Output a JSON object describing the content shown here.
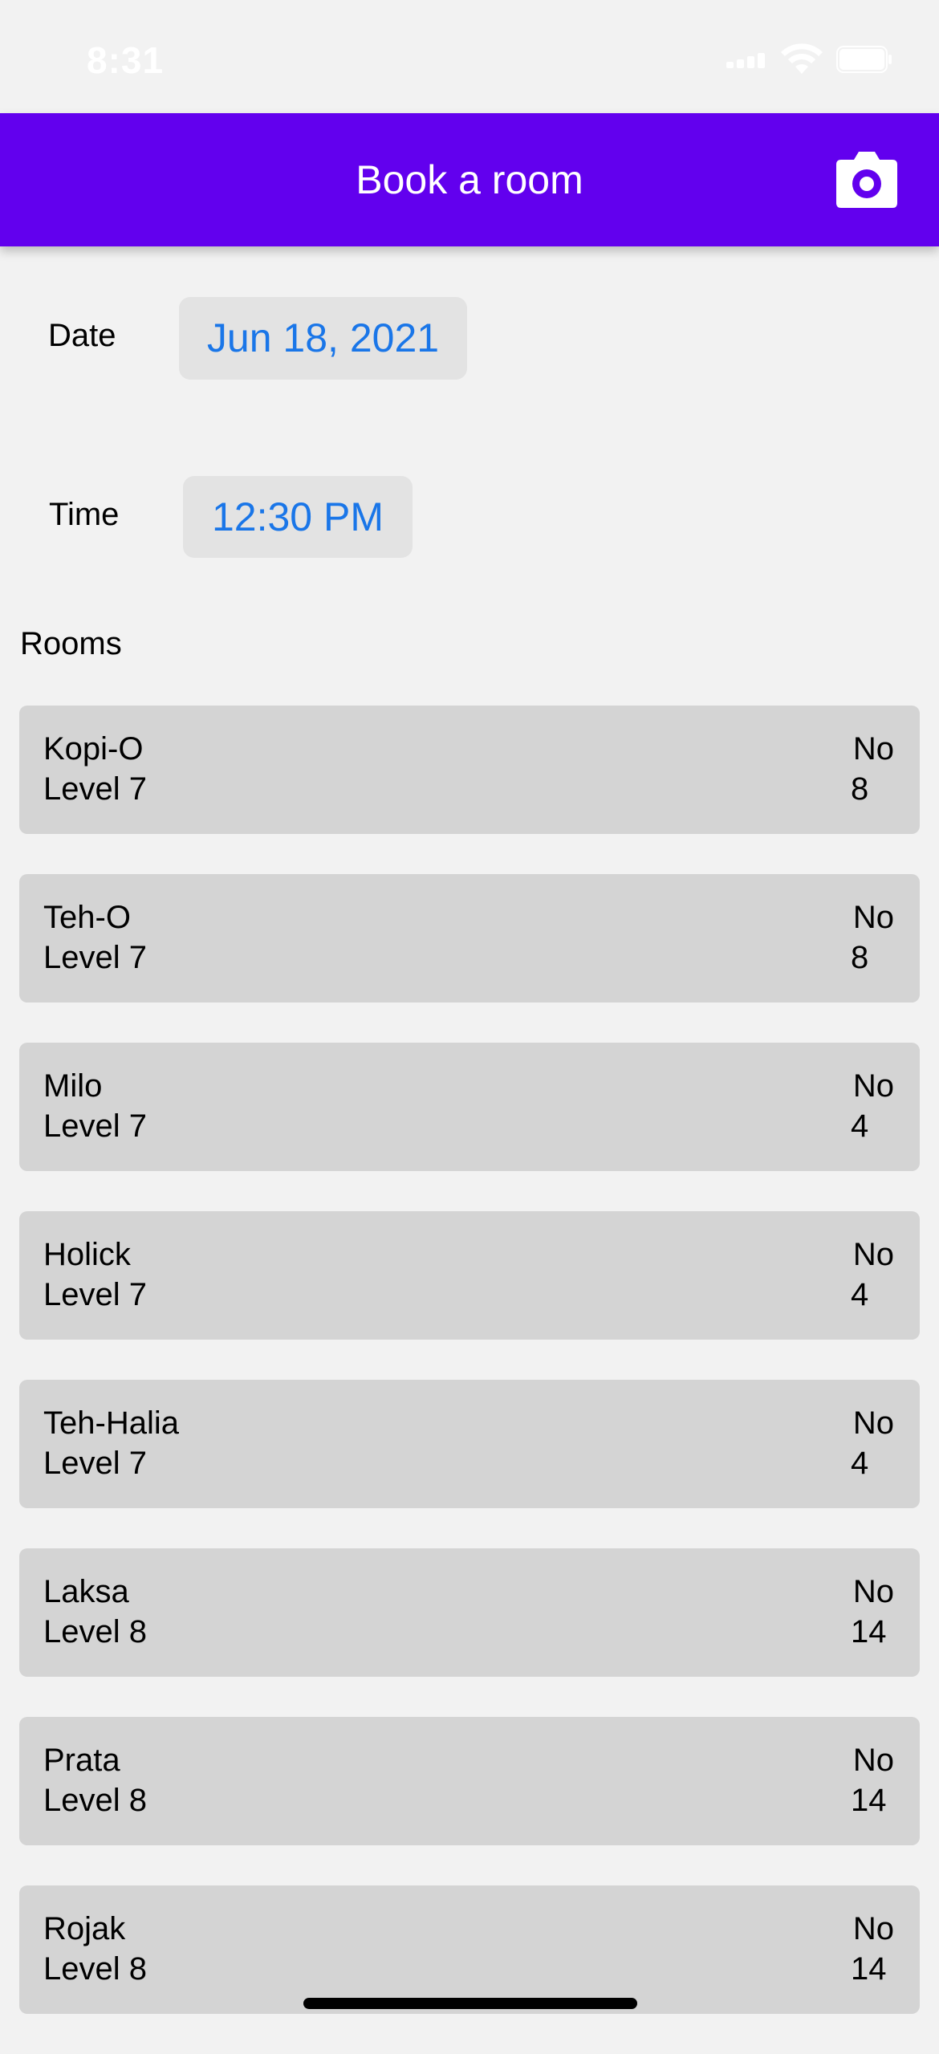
{
  "status_bar": {
    "time": "8:31"
  },
  "header": {
    "title": "Book a room",
    "action_icon": "camera-icon"
  },
  "form": {
    "date_label": "Date",
    "date_value": "Jun 18, 2021",
    "time_label": "Time",
    "time_value": "12:30 PM"
  },
  "rooms_title": "Rooms",
  "rooms": [
    {
      "name": "Kopi-O",
      "level": "Level 7",
      "status": "No",
      "capacity": "8"
    },
    {
      "name": "Teh-O",
      "level": "Level 7",
      "status": "No",
      "capacity": "8"
    },
    {
      "name": "Milo",
      "level": "Level 7",
      "status": "No",
      "capacity": "4"
    },
    {
      "name": "Holick",
      "level": "Level 7",
      "status": "No",
      "capacity": "4"
    },
    {
      "name": "Teh-Halia",
      "level": "Level 7",
      "status": "No",
      "capacity": "4"
    },
    {
      "name": "Laksa",
      "level": "Level 8",
      "status": "No",
      "capacity": "14"
    },
    {
      "name": "Prata",
      "level": "Level 8",
      "status": "No",
      "capacity": "14"
    },
    {
      "name": "Rojak",
      "level": "Level 8",
      "status": "No",
      "capacity": "14"
    }
  ],
  "colors": {
    "header": "#6200ee",
    "accent_text": "#1a76e8",
    "card": "#d4d4d4",
    "background": "#f2f2f2"
  }
}
